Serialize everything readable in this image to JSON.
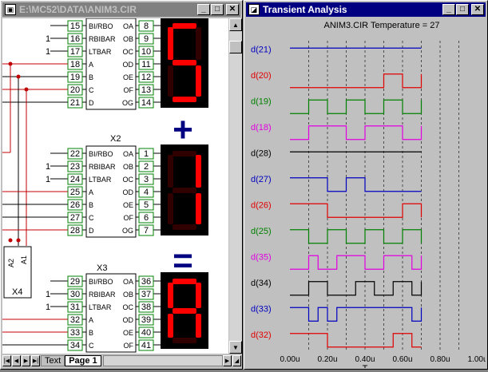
{
  "schematic_window": {
    "title": "E:\\MC52\\DATA\\ANIM3.CIR",
    "tabs": [
      "Text",
      "Page 1"
    ],
    "selected_tab": "Page 1",
    "labels": {
      "x2": "X2",
      "x3": "X3",
      "x4": "X4",
      "a1": "A1",
      "a2": "A2"
    },
    "decoder_pins_left": [
      "BI/RBO",
      "RBIBAR",
      "LTBAR",
      "A",
      "B",
      "C",
      "D"
    ],
    "decoder_pins_right_top": [
      "OA",
      "OB",
      "OC",
      "OD",
      "OE",
      "OF",
      "OG"
    ],
    "decoder_pins_right_mid": [
      "OA",
      "OB",
      "OC",
      "OD",
      "OE",
      "OF",
      "OG"
    ],
    "decoder_pins_right_bot": [
      "OA",
      "OB",
      "OC",
      "OD",
      "OE",
      "OF",
      "OG"
    ],
    "top_in_nodes": [
      "15",
      "16",
      "17",
      "18",
      "19",
      "20",
      "21"
    ],
    "top_out_nodes": [
      "8",
      "9",
      "10",
      "11",
      "12",
      "13",
      "14"
    ],
    "mid_in_nodes": [
      "22",
      "23",
      "24",
      "25",
      "26",
      "27",
      "28"
    ],
    "mid_out_nodes": [
      "1",
      "2",
      "3",
      "4",
      "5",
      "6",
      "7"
    ],
    "bot_in_nodes": [
      "29",
      "30",
      "31",
      "32",
      "33",
      "34"
    ],
    "bot_out_nodes": [
      "36",
      "37",
      "38",
      "39",
      "40",
      "41"
    ],
    "bias_one": "1",
    "plus_sign": "+",
    "equals_sign": "="
  },
  "analysis_window": {
    "title": "Transient Analysis",
    "plot_title": "ANIM3.CIR Temperature = 27",
    "x_axis_label": "T"
  },
  "colors": {
    "title_active": "#000080",
    "title_inactive": "#808080",
    "node_green": "#008000",
    "segment_red": "#ff0000",
    "wire_red": "#c00000",
    "trace_blue": "#0000c0",
    "trace_red": "#e00000",
    "trace_green": "#008000",
    "trace_magenta": "#e000e0",
    "trace_black": "#000000"
  },
  "chart_data": {
    "type": "line",
    "title": "ANIM3.CIR Temperature = 27",
    "xlabel": "T",
    "ylabel": "",
    "xlim": [
      0,
      1.0
    ],
    "x_ticks": [
      "0.00u",
      "0.20u",
      "0.40u",
      "0.60u",
      "0.80u",
      "1.00u"
    ],
    "x_tick_values": [
      0,
      0.2,
      0.4,
      0.6,
      0.8,
      1.0
    ],
    "grid": true,
    "series": [
      {
        "name": "d(21)",
        "color": "#0000c0",
        "transitions": [],
        "initial": 1
      },
      {
        "name": "d(20)",
        "color": "#e00000",
        "transitions": [
          0.5,
          0.6,
          0.7
        ],
        "initial": 0
      },
      {
        "name": "d(19)",
        "color": "#008000",
        "transitions": [
          0.1,
          0.2,
          0.3,
          0.4,
          0.5,
          0.6,
          0.7
        ],
        "initial": 0
      },
      {
        "name": "d(18)",
        "color": "#e000e0",
        "transitions": [
          0.1,
          0.3,
          0.4,
          0.6,
          0.7
        ],
        "initial": 0
      },
      {
        "name": "d(28)",
        "color": "#000000",
        "transitions": [],
        "initial": 1
      },
      {
        "name": "d(27)",
        "color": "#0000c0",
        "transitions": [
          0.2,
          0.3,
          0.4
        ],
        "initial": 1
      },
      {
        "name": "d(26)",
        "color": "#e00000",
        "transitions": [
          0.2,
          0.6,
          0.7
        ],
        "initial": 1
      },
      {
        "name": "d(25)",
        "color": "#008000",
        "transitions": [
          0.1,
          0.2,
          0.3,
          0.4,
          0.5,
          0.6,
          0.7
        ],
        "initial": 1
      },
      {
        "name": "d(35)",
        "color": "#e000e0",
        "transitions": [
          0.1,
          0.15,
          0.25,
          0.4,
          0.5,
          0.65,
          0.7
        ],
        "initial": 0
      },
      {
        "name": "d(34)",
        "color": "#000000",
        "transitions": [
          0.1,
          0.2,
          0.35,
          0.45,
          0.55,
          0.65,
          0.7
        ],
        "initial": 0
      },
      {
        "name": "d(33)",
        "color": "#0000c0",
        "transitions": [
          0.1,
          0.15,
          0.2,
          0.25,
          0.65,
          0.7
        ],
        "initial": 1
      },
      {
        "name": "d(32)",
        "color": "#e00000",
        "transitions": [
          0.2,
          0.55,
          0.65
        ],
        "initial": 1
      }
    ]
  }
}
